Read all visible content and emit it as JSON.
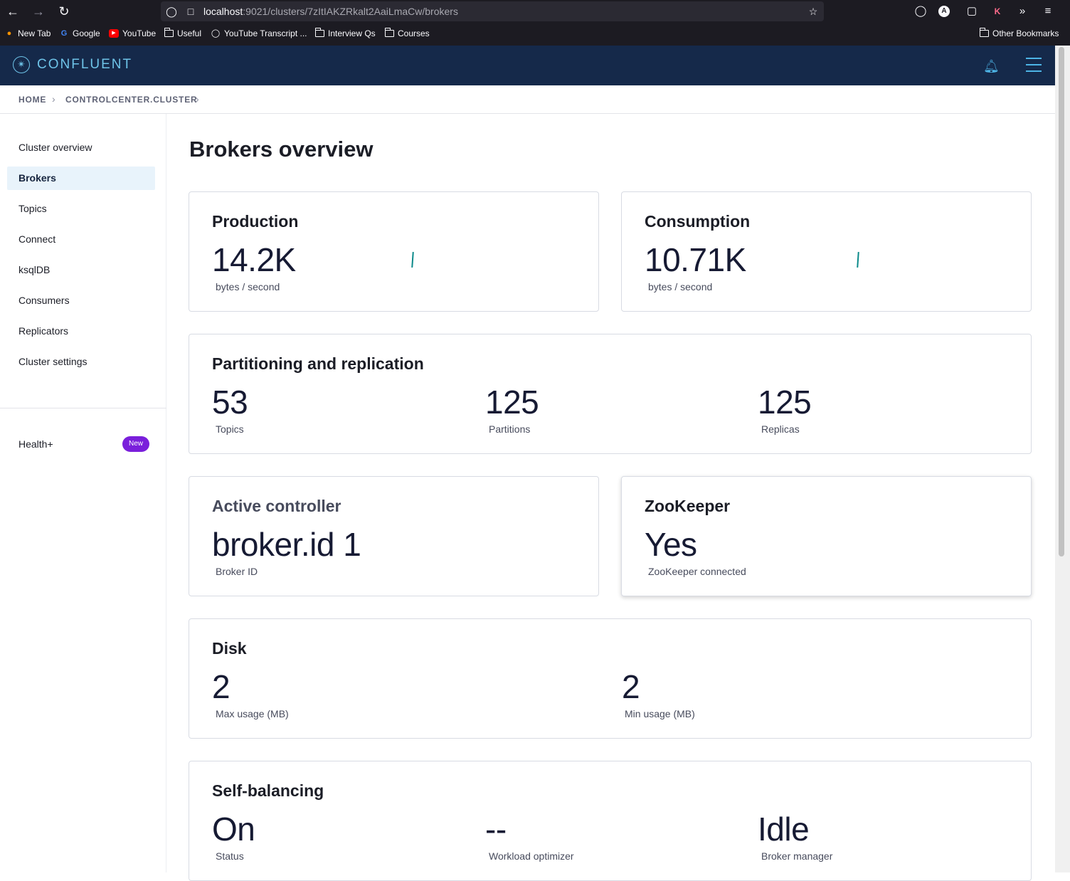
{
  "browser": {
    "url_host": "localhost",
    "url_path": ":9021/clusters/7zItIAKZRkalt2AaiLmaCw/brokers",
    "bookmarks": [
      "New Tab",
      "Google",
      "YouTube",
      "Useful",
      "YouTube Transcript ...",
      "Interview Qs",
      "Courses"
    ],
    "other_bookmarks": "Other Bookmarks"
  },
  "header": {
    "logo_text": "CONFLUENT"
  },
  "breadcrumb": [
    "HOME",
    "CONTROLCENTER.CLUSTER"
  ],
  "sidebar": {
    "items": [
      "Cluster overview",
      "Brokers",
      "Topics",
      "Connect",
      "ksqlDB",
      "Consumers",
      "Replicators",
      "Cluster settings"
    ],
    "active": "Brokers",
    "health": {
      "label": "Health+",
      "badge": "New"
    }
  },
  "page_title": "Brokers overview",
  "production": {
    "title": "Production",
    "value": "14.2K",
    "unit": "bytes / second"
  },
  "consumption": {
    "title": "Consumption",
    "value": "10.71K",
    "unit": "bytes / second"
  },
  "partitioning": {
    "title": "Partitioning and replication",
    "metrics": [
      {
        "value": "53",
        "label": "Topics"
      },
      {
        "value": "125",
        "label": "Partitions"
      },
      {
        "value": "125",
        "label": "Replicas"
      }
    ]
  },
  "controller": {
    "title": "Active controller",
    "value": "broker.id 1",
    "label": "Broker ID"
  },
  "zookeeper": {
    "title": "ZooKeeper",
    "value": "Yes",
    "label": "ZooKeeper connected"
  },
  "disk": {
    "title": "Disk",
    "metrics": [
      {
        "value": "2",
        "label": "Max usage (MB)"
      },
      {
        "value": "2",
        "label": "Min usage (MB)"
      }
    ]
  },
  "self_balancing": {
    "title": "Self-balancing",
    "metrics": [
      {
        "value": "On",
        "label": "Status"
      },
      {
        "value": "--",
        "label": "Workload optimizer"
      },
      {
        "value": "Idle",
        "label": "Broker manager"
      }
    ]
  }
}
